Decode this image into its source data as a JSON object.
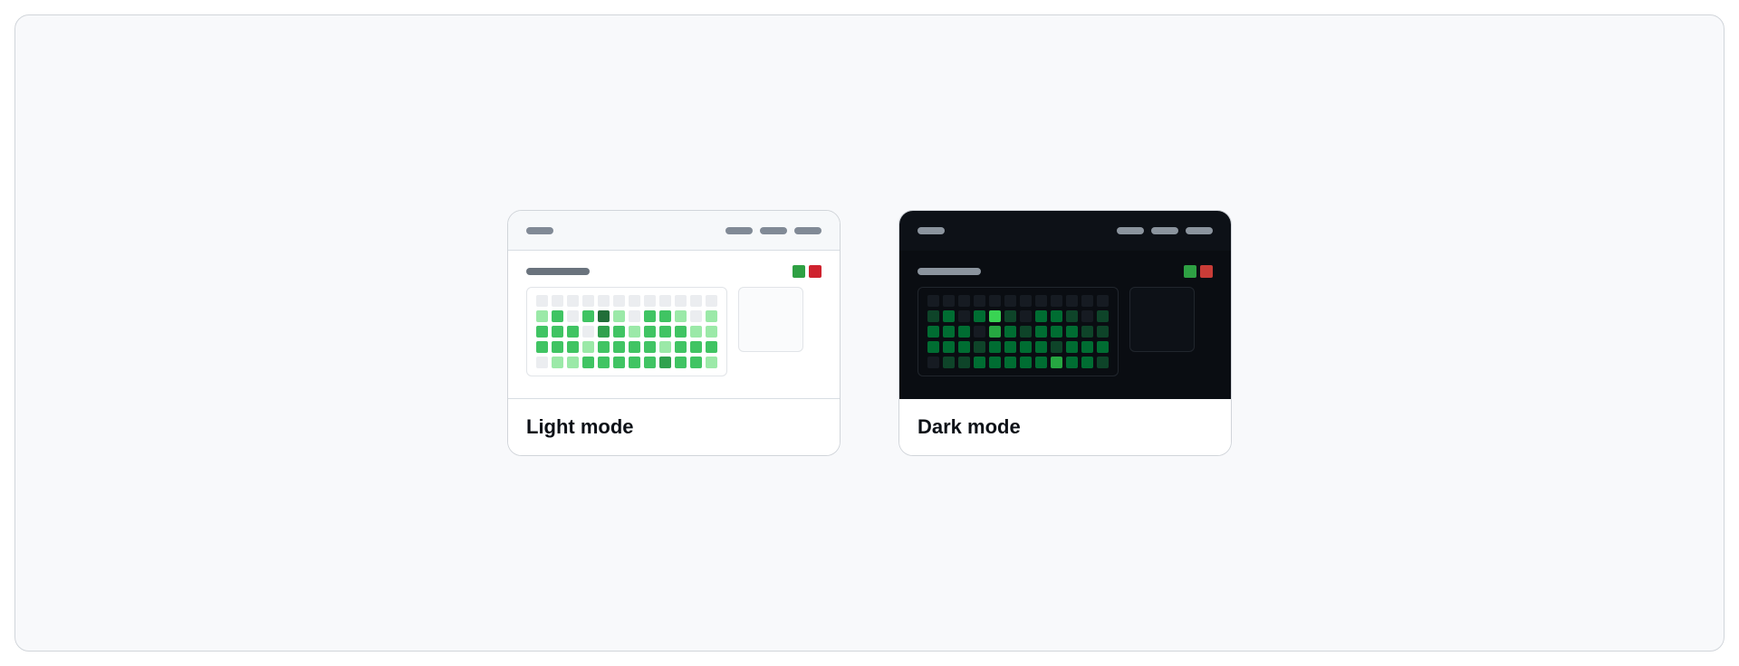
{
  "captions": {
    "light": "Light mode",
    "dark": "Dark mode"
  },
  "chart_data": {
    "type": "heatmap",
    "rows": 5,
    "cols": 12,
    "scale_desc": "0=no activity, 1=low, 2=med, 3=high, 4=max",
    "cells": [
      [
        0,
        0,
        0,
        0,
        0,
        0,
        0,
        0,
        0,
        0,
        0,
        0
      ],
      [
        1,
        2,
        0,
        2,
        4,
        1,
        0,
        2,
        2,
        1,
        0,
        1
      ],
      [
        2,
        2,
        2,
        0,
        3,
        2,
        1,
        2,
        2,
        2,
        1,
        1
      ],
      [
        2,
        2,
        2,
        1,
        2,
        2,
        2,
        2,
        1,
        2,
        2,
        2
      ],
      [
        0,
        1,
        1,
        2,
        2,
        2,
        2,
        2,
        3,
        2,
        2,
        1
      ]
    ]
  }
}
